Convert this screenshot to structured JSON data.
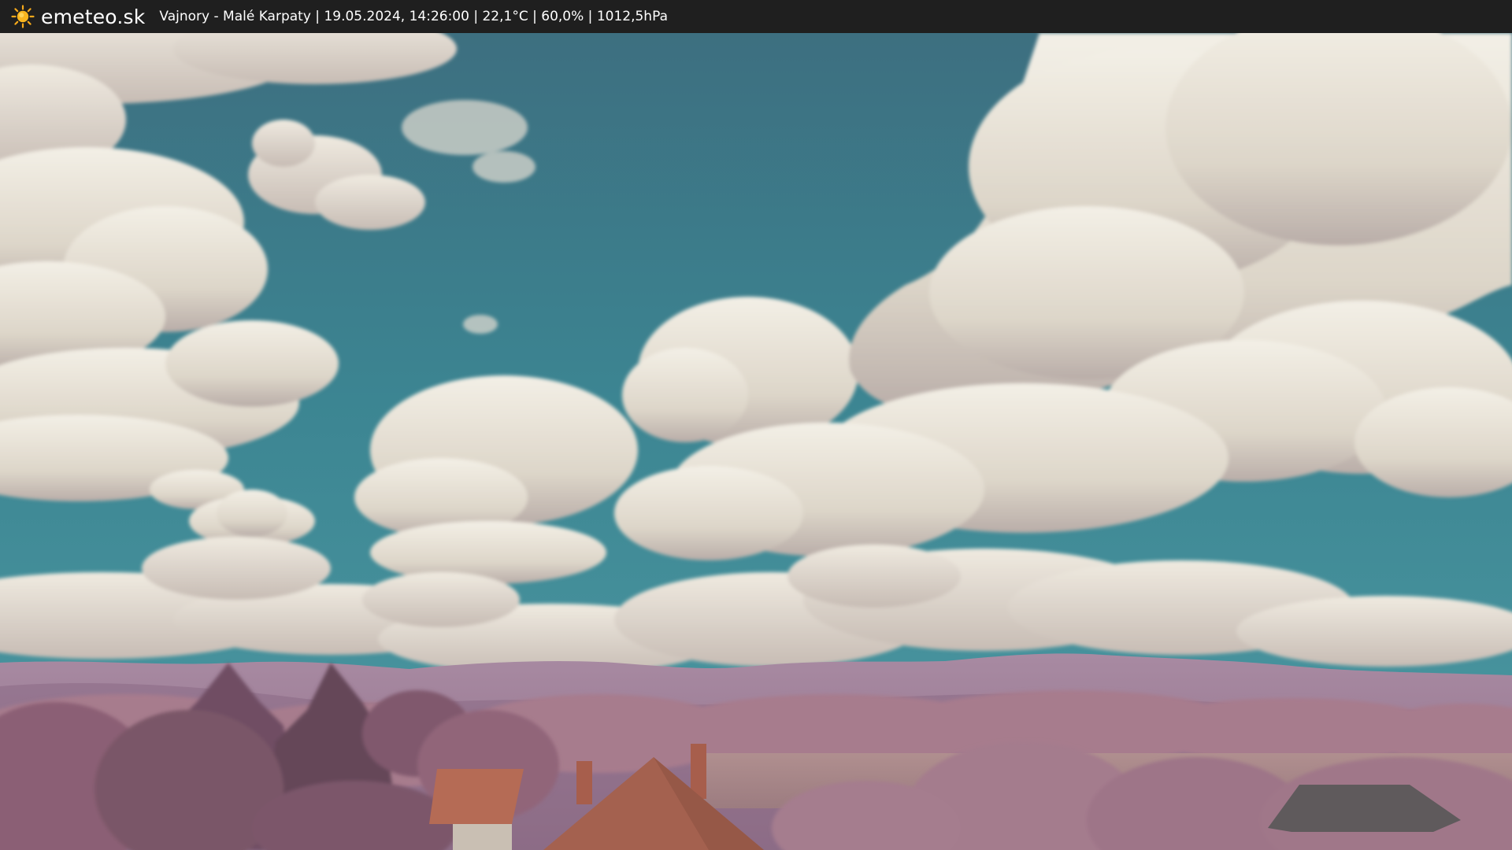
{
  "header": {
    "brand": "emeteo.sk",
    "station": "Vajnory - Malé Karpaty",
    "datetime": "19.05.2024, 14:26:00",
    "temperature": "22,1°C",
    "humidity": "60,0%",
    "pressure": "1012,5hPa",
    "separator": " | ",
    "logo_icon": "sun-icon"
  },
  "colors": {
    "bar": "#1f1f1f",
    "sky_top": "#3f7384",
    "sky_low": "#3f8e99",
    "cloud": "#eae5d9",
    "hills": "#9f7f97",
    "trees": "#a3788a",
    "sun": "#f6a91b"
  }
}
